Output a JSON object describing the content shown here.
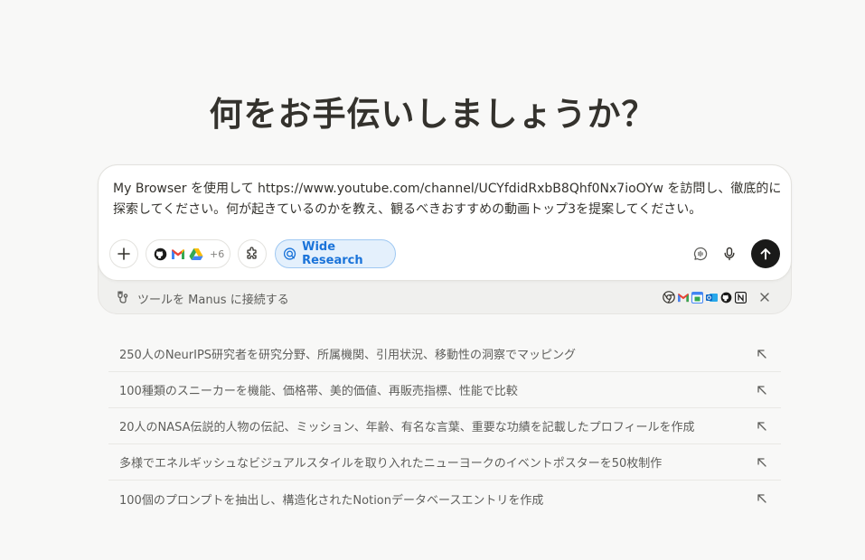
{
  "headline": "何をお手伝いしましょうか？",
  "composer": {
    "prompt_text": "My Browser を使用して https://www.youtube.com/channel/UCYfdidRxbB8Qhf0Nx7ioOYw を訪問し、徹底的に探索してください。何が起きているのかを教え、観るべきおすすめの動画トップ3を提案してください。",
    "connectors_more": "+6",
    "wide_research_label": "Wide Research",
    "icons": {
      "plus": "plus-icon",
      "github": "github-icon",
      "gmail": "gmail-icon",
      "drive": "google-drive-icon",
      "plugin": "puzzle-icon",
      "wide_research": "wide-research-icon",
      "speak": "speech-icon",
      "mic": "microphone-icon",
      "send": "arrow-up-icon"
    }
  },
  "connect_bar": {
    "label": "ツールを Manus に接続する",
    "tool_icons": [
      "chrome-icon",
      "gmail-icon",
      "calendar-icon",
      "outlook-icon",
      "github-icon",
      "notion-icon"
    ]
  },
  "suggestions": [
    {
      "text": "250人のNeurIPS研究者を研究分野、所属機関、引用状況、移動性の洞察でマッピング"
    },
    {
      "text": "100種類のスニーカーを機能、価格帯、美的価値、再販売指標、性能で比較"
    },
    {
      "text": "20人のNASA伝説的人物の伝記、ミッション、年齢、有名な言葉、重要な功績を記載したプロフィールを作成"
    },
    {
      "text": "多様でエネルギッシュなビジュアルスタイルを取り入れたニューヨークのイベントポスターを50枚制作"
    },
    {
      "text": "100個のプロンプトを抽出し、構造化されたNotionデータベースエントリを作成"
    }
  ],
  "colors": {
    "background": "#f8f8f7",
    "accent_blue": "#1a73d9",
    "send_button": "#1a1a19"
  }
}
